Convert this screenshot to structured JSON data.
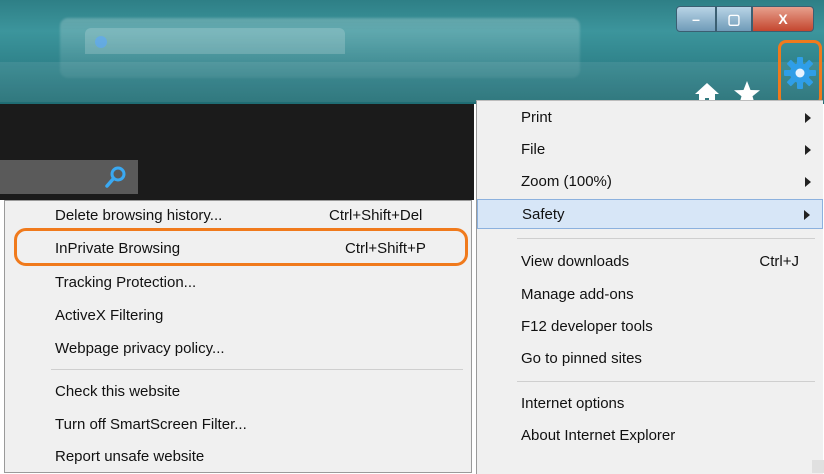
{
  "window_controls": {
    "minimize": "–",
    "maximize": "▢",
    "close": "X"
  },
  "toolbar": {
    "icons": [
      "home-icon",
      "favorites-star-icon",
      "tools-gear-icon"
    ],
    "highlight_color": "#f07a1c"
  },
  "main_menu": {
    "items": [
      {
        "label": "Print",
        "shortcut": "",
        "has_submenu": true
      },
      {
        "label": "File",
        "shortcut": "",
        "has_submenu": true
      },
      {
        "label": "Zoom (100%)",
        "shortcut": "",
        "has_submenu": true
      },
      {
        "label": "Safety",
        "shortcut": "",
        "has_submenu": true
      },
      {
        "label": "View downloads",
        "shortcut": "Ctrl+J",
        "has_submenu": false
      },
      {
        "label": "Manage add-ons",
        "shortcut": "",
        "has_submenu": false
      },
      {
        "label": "F12 developer tools",
        "shortcut": "",
        "has_submenu": false
      },
      {
        "label": "Go to pinned sites",
        "shortcut": "",
        "has_submenu": false
      },
      {
        "label": "Internet options",
        "shortcut": "",
        "has_submenu": false
      },
      {
        "label": "About Internet Explorer",
        "shortcut": "",
        "has_submenu": false
      }
    ]
  },
  "safety_submenu": {
    "items": [
      {
        "label": "Delete browsing history...",
        "shortcut": "Ctrl+Shift+Del"
      },
      {
        "label": "InPrivate Browsing",
        "shortcut": "Ctrl+Shift+P"
      },
      {
        "label": "Tracking Protection...",
        "shortcut": ""
      },
      {
        "label": "ActiveX Filtering",
        "shortcut": ""
      },
      {
        "label": "Webpage privacy policy...",
        "shortcut": ""
      },
      {
        "label": "Check this website",
        "shortcut": ""
      },
      {
        "label": "Turn off SmartScreen Filter...",
        "shortcut": ""
      },
      {
        "label": "Report unsafe website",
        "shortcut": ""
      }
    ]
  }
}
